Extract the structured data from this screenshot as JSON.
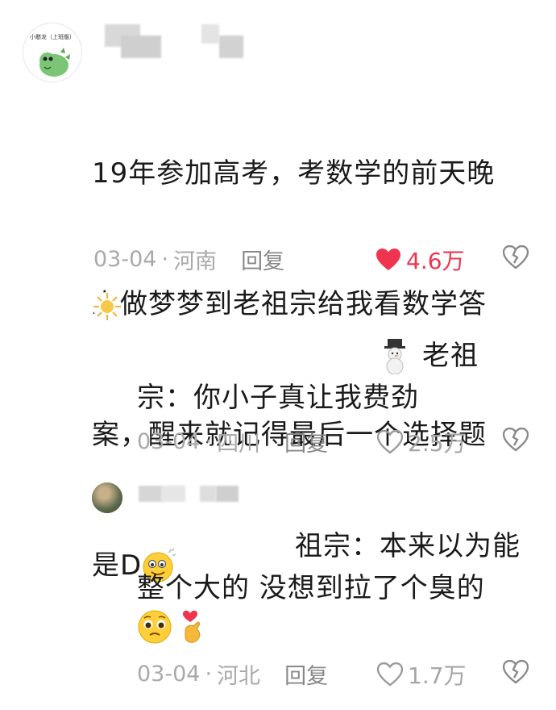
{
  "comments": [
    {
      "avatar_text": "小憨龙（上班版）",
      "lines": [
        "19年参加高考，考数学的前天晚",
        "上做梦梦到老祖宗给我看数学答",
        "案，醒来就记得最后一个选择题",
        "是D"
      ],
      "emoji": "smile-emoji",
      "date": "03-04",
      "location": "河南",
      "reply_label": "回复",
      "likes": "4.6万",
      "liked": true,
      "like_color": "#f0344f"
    },
    {
      "lines_first": "老祖",
      "lines": [
        "宗：你小子真让我费劲"
      ],
      "emoji": "snowman-emoji",
      "date": "03-04",
      "location": "四川",
      "reply_label": "回复",
      "likes": "2.5万",
      "liked": false
    },
    {
      "lines": [
        "祖宗：本来以为能",
        "整个大的 没想到拉了个臭的"
      ],
      "emoji": "pleading-face-emoji",
      "emoji2": "finger-heart-emoji",
      "date": "03-04",
      "location": "河北",
      "reply_label": "回复",
      "likes": "1.7万",
      "liked": false
    }
  ],
  "separator": "·"
}
